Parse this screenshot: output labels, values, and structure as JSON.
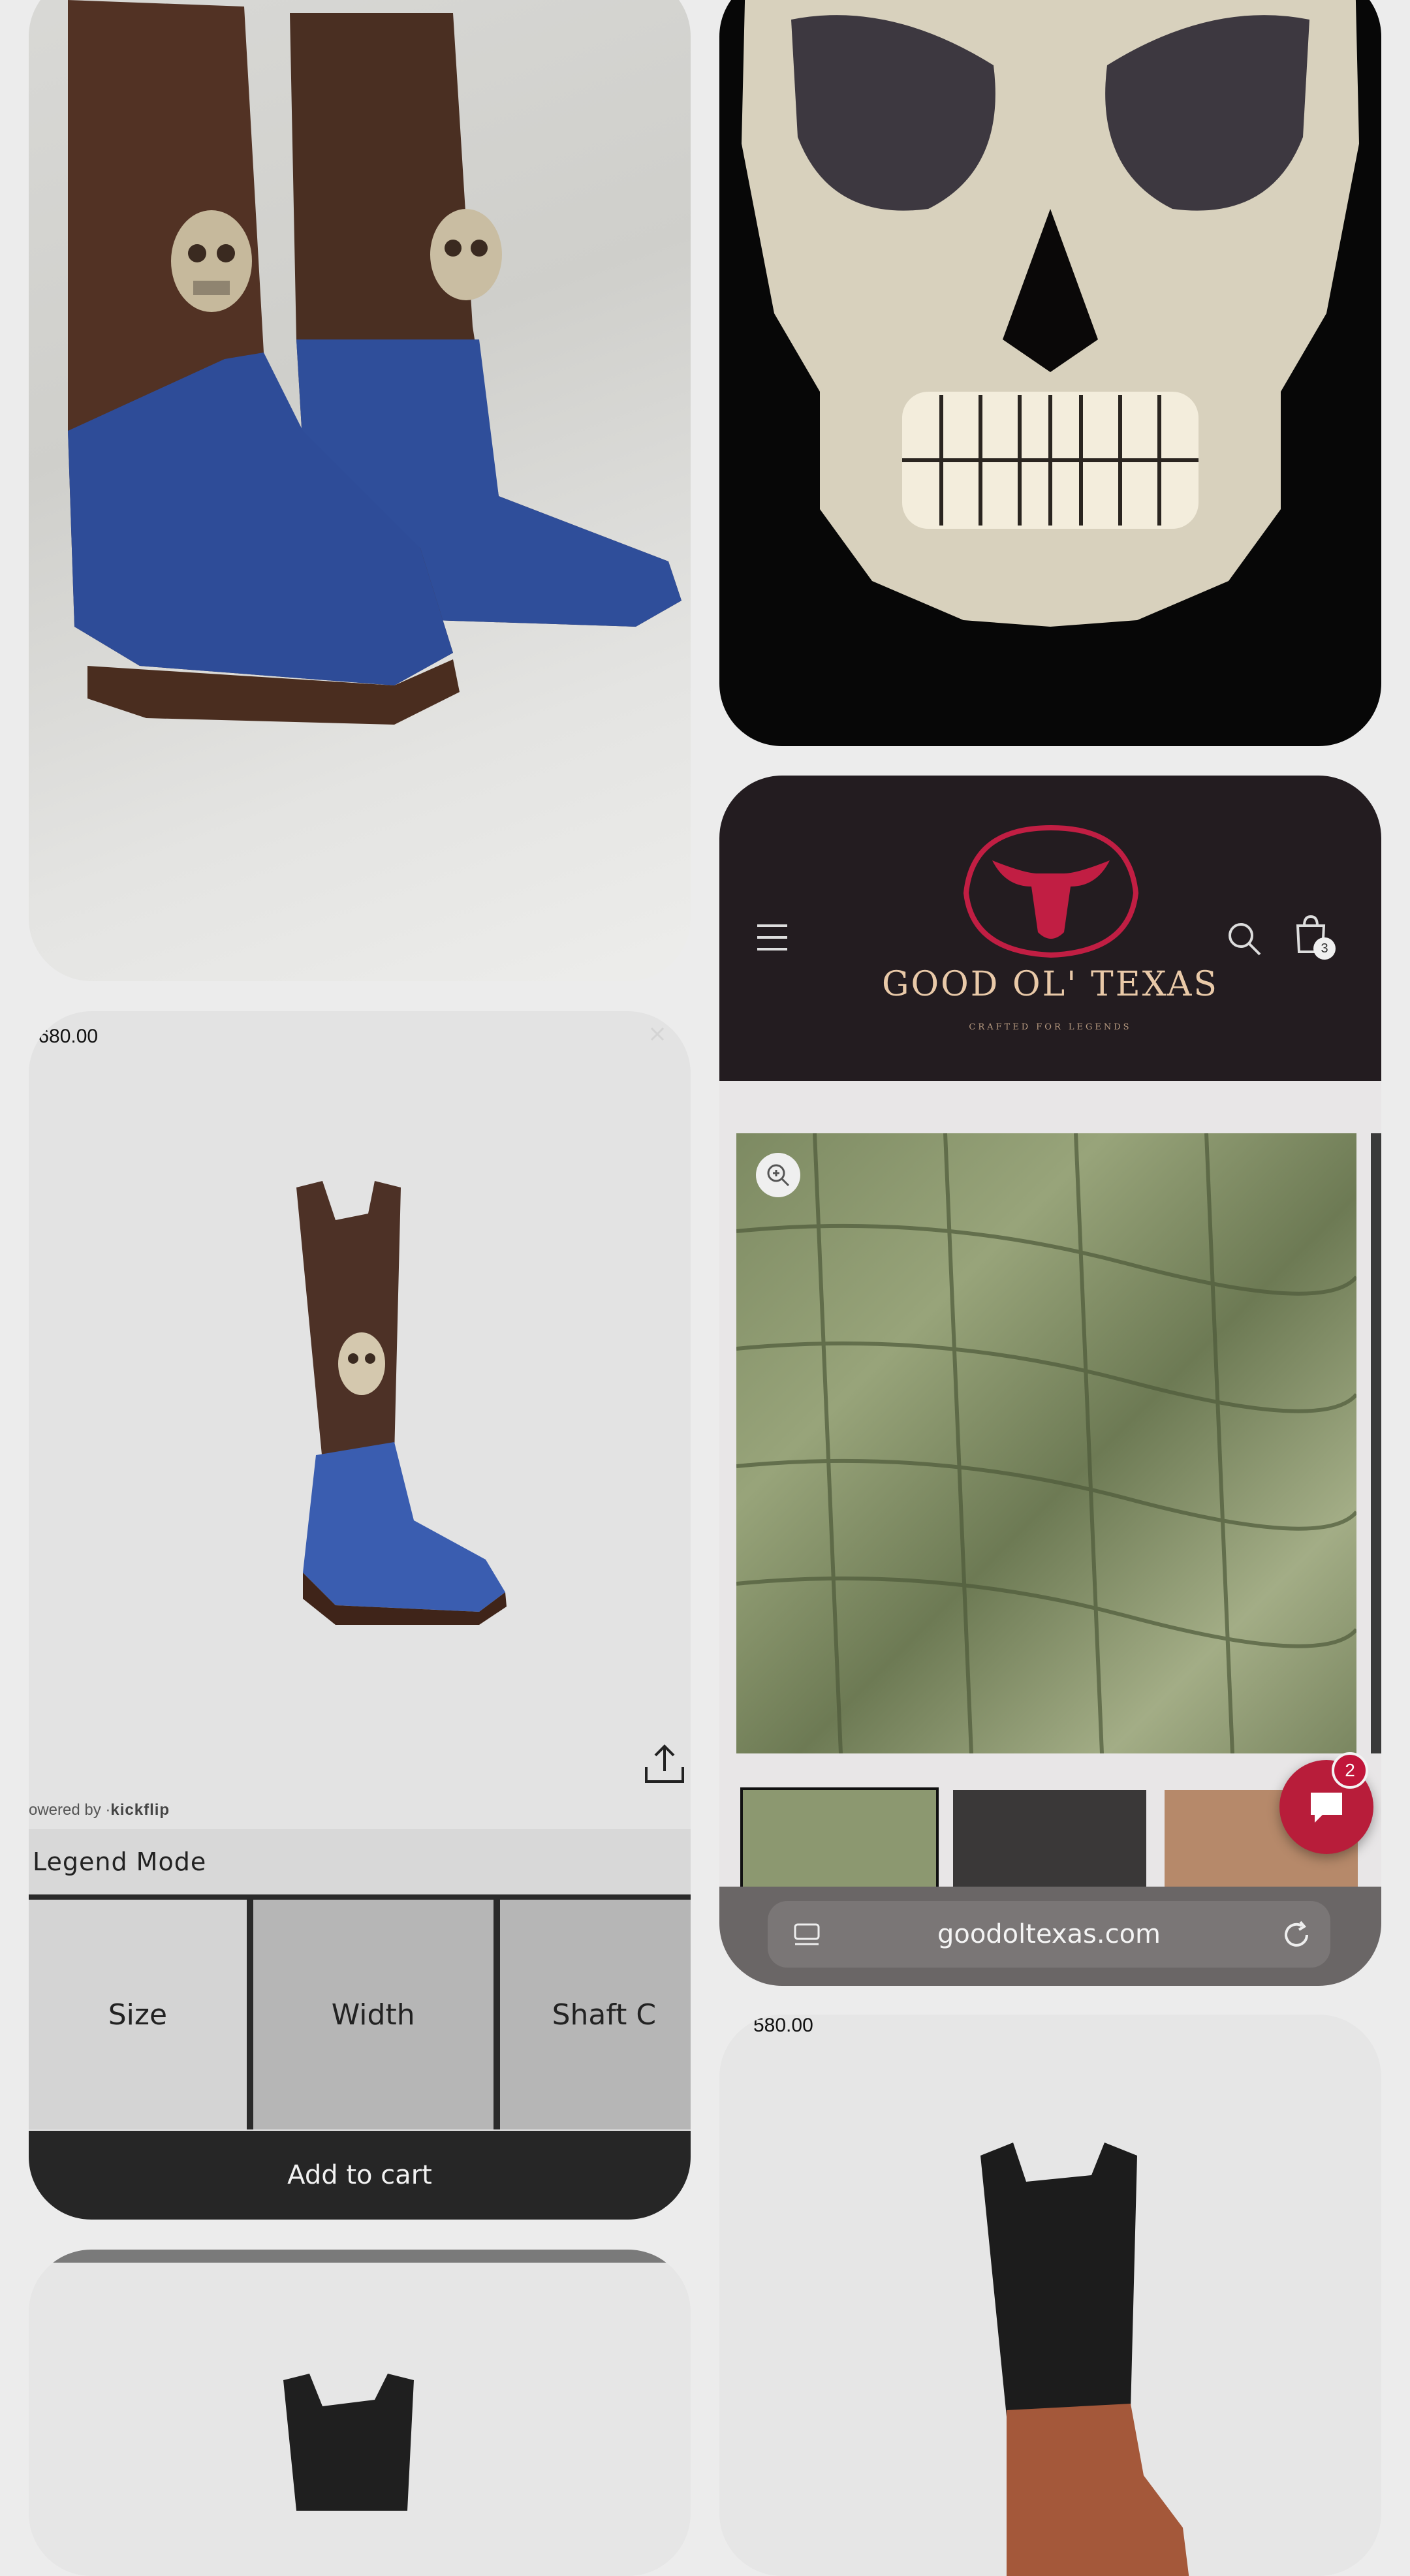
{
  "colors": {
    "page_bg": "#ececec",
    "brand_red": "#c1163a",
    "header_dark": "#231c20",
    "button_dark": "#262626",
    "boot_blue": "#3a5aa8",
    "boot_brown": "#4a3024"
  },
  "configurator": {
    "price": ",680.00",
    "powered_by_prefix": "owered by ·",
    "powered_by_brand": "kickflip",
    "legend_label": "Legend Mode",
    "options": [
      "Size",
      "Width",
      "Shaft C"
    ],
    "add_to_cart": "Add to cart",
    "icons": {
      "share": "share-upload-icon",
      "close": "close-icon"
    }
  },
  "phone": {
    "brand_name": "GOOD OL' TEXAS",
    "tagline": "CRAFTED FOR LEGENDS",
    "cart_count": "3",
    "chat_badge": "2",
    "url": "goodoltexas.com",
    "icons": {
      "menu": "hamburger-menu-icon",
      "search": "search-icon",
      "cart": "shopping-bag-icon",
      "zoom": "zoom-in-icon",
      "tabs": "tabs-icon",
      "reload": "reload-icon",
      "chat": "chat-bubble-icon"
    }
  },
  "brown_boot_card": {
    "price": "580.00"
  }
}
